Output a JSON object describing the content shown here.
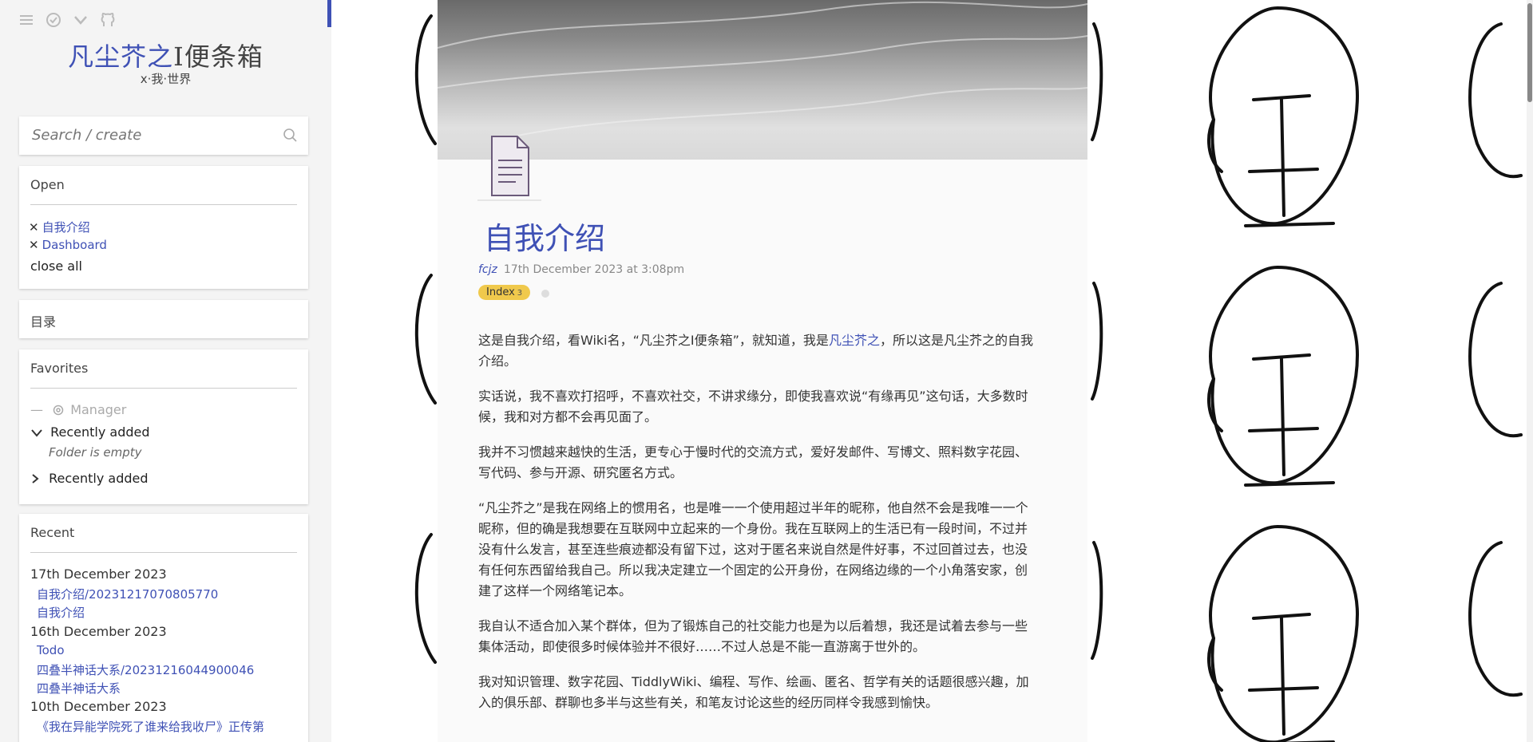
{
  "sidebar": {
    "title_main": "凡尘芥之",
    "title_rest": "I便条箱",
    "subtitle": "x·我·世界",
    "search": {
      "placeholder": "Search / create"
    },
    "open": {
      "heading": "Open",
      "items": [
        "自我介绍",
        "Dashboard"
      ],
      "close_all": "close all"
    },
    "toc": {
      "heading": "目录"
    },
    "favorites": {
      "heading": "Favorites",
      "manager_prefix": "—",
      "manager": "Manager",
      "folder1": "Recently added",
      "folder1_empty": "Folder is empty",
      "folder2": "Recently added"
    },
    "recent": {
      "heading": "Recent",
      "groups": [
        {
          "date": "17th December 2023",
          "items": [
            "自我介绍/20231217070805770",
            "自我介绍"
          ]
        },
        {
          "date": "16th December 2023",
          "items": [
            "Todo",
            "四叠半神话大系/20231216044900046",
            "四叠半神话大系"
          ]
        },
        {
          "date": "10th December 2023",
          "items": [
            "《我在异能学院死了谁来给我收尸》正传第"
          ]
        }
      ]
    }
  },
  "tiddler": {
    "title": "自我介绍",
    "author": "fcjz",
    "date": "17th December 2023 at 3:08pm",
    "tag": "Index",
    "tag_count": "3",
    "paragraphs": {
      "p1_a": "这是自我介绍，看Wiki名，“凡尘芥之I便条箱”，就知道，我是",
      "p1_link": "凡尘芥之",
      "p1_b": "，所以这是凡尘芥之的自我介绍。",
      "p2": "实话说，我不喜欢打招呼，不喜欢社交，不讲求缘分，即使我喜欢说“有缘再见”这句话，大多数时候，我和对方都不会再见面了。",
      "p3": "我并不习惯越来越快的生活，更专心于慢时代的交流方式，爱好发邮件、写博文、照料数字花园、写代码、参与开源、研究匿名方式。",
      "p4": "“凡尘芥之”是我在网络上的惯用名，也是唯一一个使用超过半年的昵称，他自然不会是我唯一一个昵称，但的确是我想要在互联网中立起来的一个身份。我在互联网上的生活已有一段时间，不过并没有什么发言，甚至连些痕迹都没有留下过，这对于匿名来说自然是件好事，不过回首过去，也没有任何东西留给我自己。所以我决定建立一个固定的公开身份，在网络边缘的一个小角落安家，创建了这样一个网络笔记本。",
      "p5": "我自认不适合加入某个群体，但为了锻炼自己的社交能力也是为以后着想，我还是试着去参与一些集体活动，即使很多时候体验并不很好……不过人总是不能一直游离于世外的。",
      "p6": "我对知识管理、数字花园、TiddlyWiki、编程、写作、绘画、匿名、哲学有关的话题很感兴趣，加入的俱乐部、群聊也多半与这些有关，和笔友讨论这些的经历同样令我感到愉快。"
    }
  },
  "colors": {
    "accent": "#3f51b5",
    "tag": "#f0c94c",
    "sidebar_bg": "#f4f4f4"
  }
}
